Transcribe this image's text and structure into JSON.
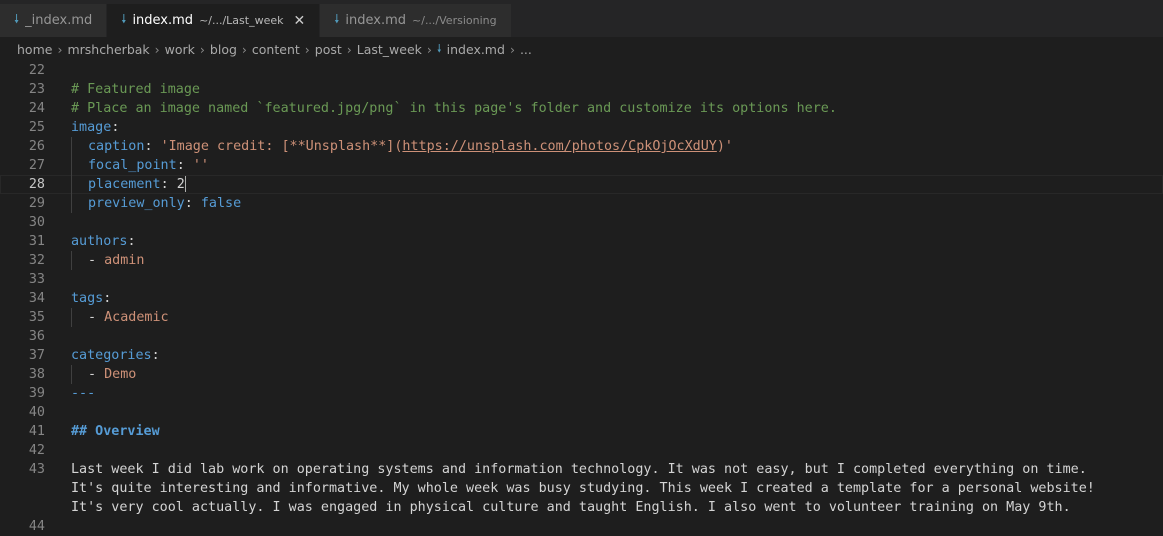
{
  "tabs": [
    {
      "label": "_index.md",
      "desc": ""
    },
    {
      "label": "index.md",
      "desc": "~/.../Last_week"
    },
    {
      "label": "index.md",
      "desc": "~/.../Versioning"
    }
  ],
  "breadcrumb": [
    "home",
    "mrshcherbak",
    "work",
    "blog",
    "content",
    "post",
    "Last_week",
    "index.md",
    "..."
  ],
  "lines": {
    "n22": "22",
    "n23": "23",
    "n24": "24",
    "n25": "25",
    "n26": "26",
    "n27": "27",
    "n28": "28",
    "n29": "29",
    "n30": "30",
    "n31": "31",
    "n32": "32",
    "n33": "33",
    "n34": "34",
    "n35": "35",
    "n36": "36",
    "n37": "37",
    "n38": "38",
    "n39": "39",
    "n40": "40",
    "n41": "41",
    "n42": "42",
    "n43": "43",
    "n44": "44",
    "l23": "# Featured image",
    "l24": "# Place an image named `featured.jpg/png` in this page's folder and customize its options here.",
    "l25_key": "image",
    "l26_key": "caption",
    "l26_val_a": "'Image credit: [**Unsplash**](",
    "l26_url": "https://unsplash.com/photos/CpkOjOcXdUY",
    "l26_val_b": ")'",
    "l27_key": "focal_point",
    "l27_val": "''",
    "l28_key": "placement",
    "l28_val": "2",
    "l29_key": "preview_only",
    "l29_val": "false",
    "l31_key": "authors",
    "l32_val": "admin",
    "l34_key": "tags",
    "l35_val": "Academic",
    "l37_key": "categories",
    "l38_val": "Demo",
    "l39": "---",
    "l41": "## Overview",
    "l43a": "Last week I did lab work on operating systems and information technology. It was not easy, but I completed everything on time.",
    "l43b": "It's quite interesting and informative. My whole week was busy studying. This week I created a template for a personal website!",
    "l43c": "It's very cool actually. I was engaged in physical culture and taught English. I also went to volunteer training on May 9th."
  }
}
